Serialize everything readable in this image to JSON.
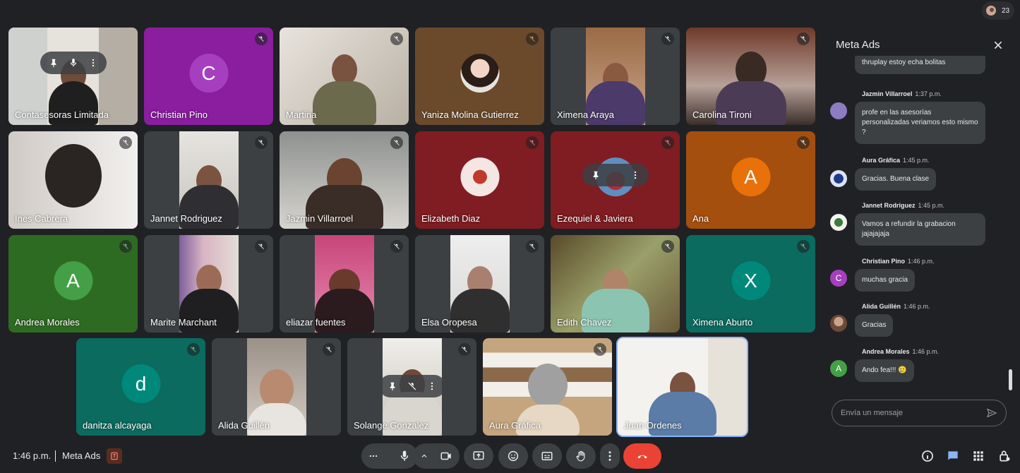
{
  "participant_count": "23",
  "participants": [
    {
      "name": "Contasesoras Limitada"
    },
    {
      "name": "Christian Pino",
      "initial": "C",
      "color": "#8a1e9e"
    },
    {
      "name": "Martina"
    },
    {
      "name": "Yaniza Molina Gutierrez"
    },
    {
      "name": "Ximena Araya"
    },
    {
      "name": "Carolina Tironi"
    },
    {
      "name": "Ines Cabrera"
    },
    {
      "name": "Jannet Rodriguez"
    },
    {
      "name": "Jazmin Villarroel"
    },
    {
      "name": "Elizabeth Diaz"
    },
    {
      "name": "Ezequiel & Javiera"
    },
    {
      "name": "Ana",
      "initial": "A",
      "color": "#e8710a"
    },
    {
      "name": "Andrea Morales",
      "initial": "A",
      "color": "#43a047"
    },
    {
      "name": "Marite Marchant"
    },
    {
      "name": "eliazar fuentes"
    },
    {
      "name": "Elsa Oropesa"
    },
    {
      "name": "Edith Chavez"
    },
    {
      "name": "Ximena Aburto",
      "initial": "X",
      "color": "#00897b"
    },
    {
      "name": "danitza alcayaga",
      "initial": "d",
      "color": "#00897b"
    },
    {
      "name": "Alida Guillén"
    },
    {
      "name": "Solange Gonzalez"
    },
    {
      "name": "Aura Gráfica"
    },
    {
      "name": "Juan Ordenes"
    }
  ],
  "chat": {
    "title": "Meta Ads",
    "input_placeholder": "Envía un mensaje",
    "messages": [
      {
        "author": "",
        "time": "",
        "text": "thruplay estoy echa bolitas"
      },
      {
        "author": "Jazmin Villarroel",
        "time": "1:37 p.m.",
        "text": "profe en las asesorías personalizadas  veriamos  esto mismo ?"
      },
      {
        "author": "Aura Gráfica",
        "time": "1:45 p.m.",
        "text": "Gracias. Buena clase"
      },
      {
        "author": "Jannet Rodriguez",
        "time": "1:45 p.m.",
        "text": "Vamos a refundir la grabacion jajajajaja"
      },
      {
        "author": "Christian Pino",
        "time": "1:46 p.m.",
        "text": "muchas gracia",
        "initial": "C"
      },
      {
        "author": "Alida Guillén",
        "time": "1:46 p.m.",
        "text": "Gracias"
      },
      {
        "author": "Andrea Morales",
        "time": "1:46 p.m.",
        "text": "Ando fea!!! 🥲",
        "initial": "A"
      }
    ]
  },
  "bottom": {
    "time": "1:46 p.m.",
    "meeting_title": "Meta Ads"
  }
}
